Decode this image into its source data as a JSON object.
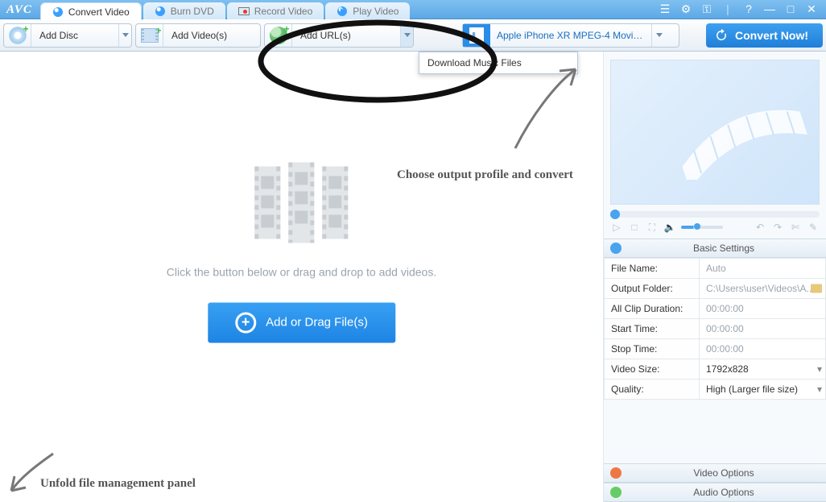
{
  "app": {
    "logo": "AVC"
  },
  "tabs": {
    "convert": "Convert Video",
    "burn": "Burn DVD",
    "record": "Record Video",
    "play": "Play Video"
  },
  "toolbar": {
    "add_disc": "Add Disc",
    "add_video": "Add Video(s)",
    "add_url": "Add URL(s)",
    "profile": "Apple iPhone XR MPEG-4 Movie (*.m...",
    "convert": "Convert Now!"
  },
  "url_menu": {
    "download_music": "Download Music Files"
  },
  "canvas": {
    "hint": "Click the button below or drag and drop to add videos.",
    "add_button": "Add or Drag File(s)"
  },
  "annotations": {
    "profile": "Choose output profile and convert",
    "unfold": "Unfold file management panel"
  },
  "panel_headers": {
    "basic": "Basic Settings",
    "video": "Video Options",
    "audio": "Audio Options"
  },
  "settings": {
    "file_name": {
      "label": "File Name:",
      "value": "Auto"
    },
    "output_folder": {
      "label": "Output Folder:",
      "value": "C:\\Users\\user\\Videos\\A..."
    },
    "all_clip_duration": {
      "label": "All Clip Duration:",
      "value": "00:00:00"
    },
    "start_time": {
      "label": "Start Time:",
      "value": "00:00:00"
    },
    "stop_time": {
      "label": "Stop Time:",
      "value": "00:00:00"
    },
    "video_size": {
      "label": "Video Size:",
      "value": "1792x828"
    },
    "quality": {
      "label": "Quality:",
      "value": "High (Larger file size)"
    }
  }
}
